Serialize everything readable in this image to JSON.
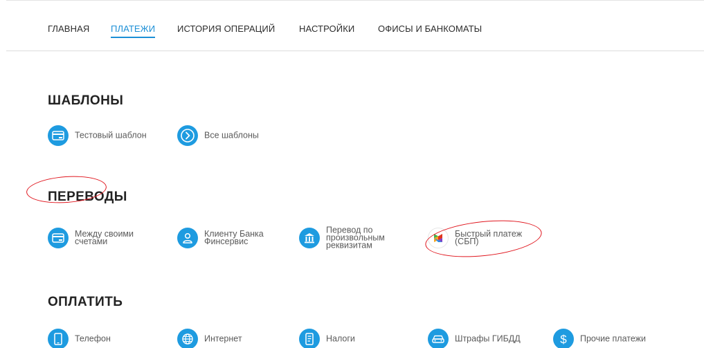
{
  "nav": {
    "items": [
      {
        "label": "ГЛАВНАЯ",
        "active": false
      },
      {
        "label": "ПЛАТЕЖИ",
        "active": true
      },
      {
        "label": "ИСТОРИЯ ОПЕРАЦИЙ",
        "active": false
      },
      {
        "label": "НАСТРОЙКИ",
        "active": false
      },
      {
        "label": "ОФИСЫ И БАНКОМАТЫ",
        "active": false
      }
    ]
  },
  "sections": {
    "templates": {
      "title": "ШАБЛОНЫ",
      "items": [
        {
          "label": "Тестовый шаблон",
          "icon": "card-icon"
        },
        {
          "label": "Все шаблоны",
          "icon": "chevron-right-icon"
        }
      ]
    },
    "transfers": {
      "title": "ПЕРЕВОДЫ",
      "items": [
        {
          "label": "Между своими\nсчетами",
          "icon": "card-icon"
        },
        {
          "label": "Клиенту Банка\nФинсервис",
          "icon": "person-icon"
        },
        {
          "label": "Перевод по\nпроизвольным\nреквизитам",
          "icon": "bank-icon"
        },
        {
          "label": "Быстрый платеж\n(СБП)",
          "icon": "sbp-logo-icon"
        }
      ]
    },
    "pay": {
      "title": "ОПЛАТИТЬ",
      "items": [
        {
          "label": "Телефон",
          "icon": "phone-icon"
        },
        {
          "label": "Интернет",
          "icon": "globe-icon"
        },
        {
          "label": "Налоги",
          "icon": "document-icon"
        },
        {
          "label": "Штрафы ГИБДД",
          "icon": "car-icon"
        },
        {
          "label": "Прочие платежи",
          "icon": "dollar-icon"
        }
      ]
    }
  },
  "colors": {
    "accent": "#1e9be0",
    "nav_active": "#1b8fd6",
    "annotation": "#e0141c"
  }
}
